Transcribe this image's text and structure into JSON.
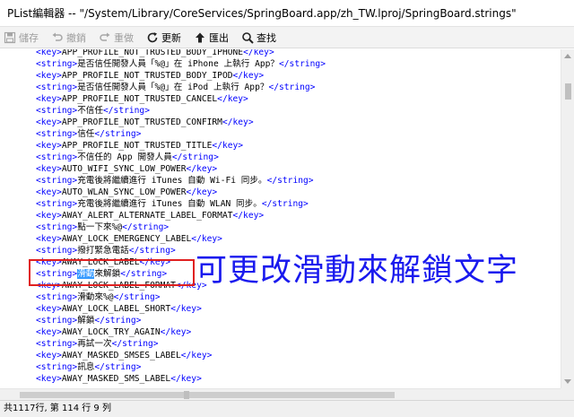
{
  "window": {
    "title": "PList編輯器  --  \"/System/Library/CoreServices/SpringBoard.app/zh_TW.lproj/SpringBoard.strings\""
  },
  "toolbar": {
    "save_label": "儲存",
    "undo_label": "撤銷",
    "redo_label": "重做",
    "refresh_label": "更新",
    "export_label": "匯出",
    "find_label": "查找"
  },
  "editor": {
    "lines": [
      {
        "pre": "",
        "tag_open": "<key>",
        "text": "APP_PROFILE_NOT_TRUSTED_BODY_IPHONE",
        "tag_close": "</key>"
      },
      {
        "pre": "",
        "tag_open": "<string>",
        "text": "是否信任開發人員「%@」在 iPhone 上執行 App？",
        "tag_close": "</string>"
      },
      {
        "pre": "",
        "tag_open": "<key>",
        "text": "APP_PROFILE_NOT_TRUSTED_BODY_IPOD",
        "tag_close": "</key>"
      },
      {
        "pre": "",
        "tag_open": "<string>",
        "text": "是否信任開發人員「%@」在 iPod 上執行 App？",
        "tag_close": "</string>"
      },
      {
        "pre": "",
        "tag_open": "<key>",
        "text": "APP_PROFILE_NOT_TRUSTED_CANCEL",
        "tag_close": "</key>"
      },
      {
        "pre": "",
        "tag_open": "<string>",
        "text": "不信任",
        "tag_close": "</string>"
      },
      {
        "pre": "",
        "tag_open": "<key>",
        "text": "APP_PROFILE_NOT_TRUSTED_CONFIRM",
        "tag_close": "</key>"
      },
      {
        "pre": "",
        "tag_open": "<string>",
        "text": "信任",
        "tag_close": "</string>"
      },
      {
        "pre": "",
        "tag_open": "<key>",
        "text": "APP_PROFILE_NOT_TRUSTED_TITLE",
        "tag_close": "</key>"
      },
      {
        "pre": "",
        "tag_open": "<string>",
        "text": "不信任的 App 開發人員",
        "tag_close": "</string>"
      },
      {
        "pre": "",
        "tag_open": "<key>",
        "text": "AUTO_WIFI_SYNC_LOW_POWER",
        "tag_close": "</key>"
      },
      {
        "pre": "",
        "tag_open": "<string>",
        "text": "充電後將繼續進行 iTunes 自動 Wi-Fi 同步。",
        "tag_close": "</string>"
      },
      {
        "pre": "",
        "tag_open": "<key>",
        "text": "AUTO_WLAN_SYNC_LOW_POWER",
        "tag_close": "</key>"
      },
      {
        "pre": "",
        "tag_open": "<string>",
        "text": "充電後將繼續進行 iTunes 自動 WLAN 同步。",
        "tag_close": "</string>"
      },
      {
        "pre": "",
        "tag_open": "<key>",
        "text": "AWAY_ALERT_ALTERNATE_LABEL_FORMAT",
        "tag_close": "</key>"
      },
      {
        "pre": "",
        "tag_open": "<string>",
        "text": "點一下來%@",
        "tag_close": "</string>"
      },
      {
        "pre": "",
        "tag_open": "<key>",
        "text": "AWAY_LOCK_EMERGENCY_LABEL",
        "tag_close": "</key>"
      },
      {
        "pre": "",
        "tag_open": "<string>",
        "text": "撥打緊急電話",
        "tag_close": "</string>"
      },
      {
        "pre": "",
        "tag_open": "<key>",
        "text": "AWAY_LOCK_LABEL",
        "tag_close": "</key>"
      },
      {
        "pre": "",
        "tag_open": "<string>",
        "sel": "滑動",
        "text": "來解鎖",
        "tag_close": "</string>"
      },
      {
        "pre": "",
        "tag_open": "<key>",
        "text": "AWAY_LOCK_LABEL_FORMAT",
        "tag_close": "</key>"
      },
      {
        "pre": "",
        "tag_open": "<string>",
        "text": "滑動來%@",
        "tag_close": "</string>"
      },
      {
        "pre": "",
        "tag_open": "<key>",
        "text": "AWAY_LOCK_LABEL_SHORT",
        "tag_close": "</key>"
      },
      {
        "pre": "",
        "tag_open": "<string>",
        "text": "解鎖",
        "tag_close": "</string>"
      },
      {
        "pre": "",
        "tag_open": "<key>",
        "text": "AWAY_LOCK_TRY_AGAIN",
        "tag_close": "</key>"
      },
      {
        "pre": "",
        "tag_open": "<string>",
        "text": "再試一次",
        "tag_close": "</string>"
      },
      {
        "pre": "",
        "tag_open": "<key>",
        "text": "AWAY_MASKED_SMSES_LABEL",
        "tag_close": "</key>"
      },
      {
        "pre": "",
        "tag_open": "<string>",
        "text": "訊息",
        "tag_close": "</string>"
      },
      {
        "pre": "",
        "tag_open": "<key>",
        "text": "AWAY_MASKED_SMS_LABEL",
        "tag_close": "</key>"
      }
    ]
  },
  "status": {
    "text": "共1117行, 第 114 行 9 列"
  },
  "annotation": {
    "text": "可更改滑動來解鎖文字",
    "color": "#1a1aee",
    "box_color": "#e02020"
  }
}
